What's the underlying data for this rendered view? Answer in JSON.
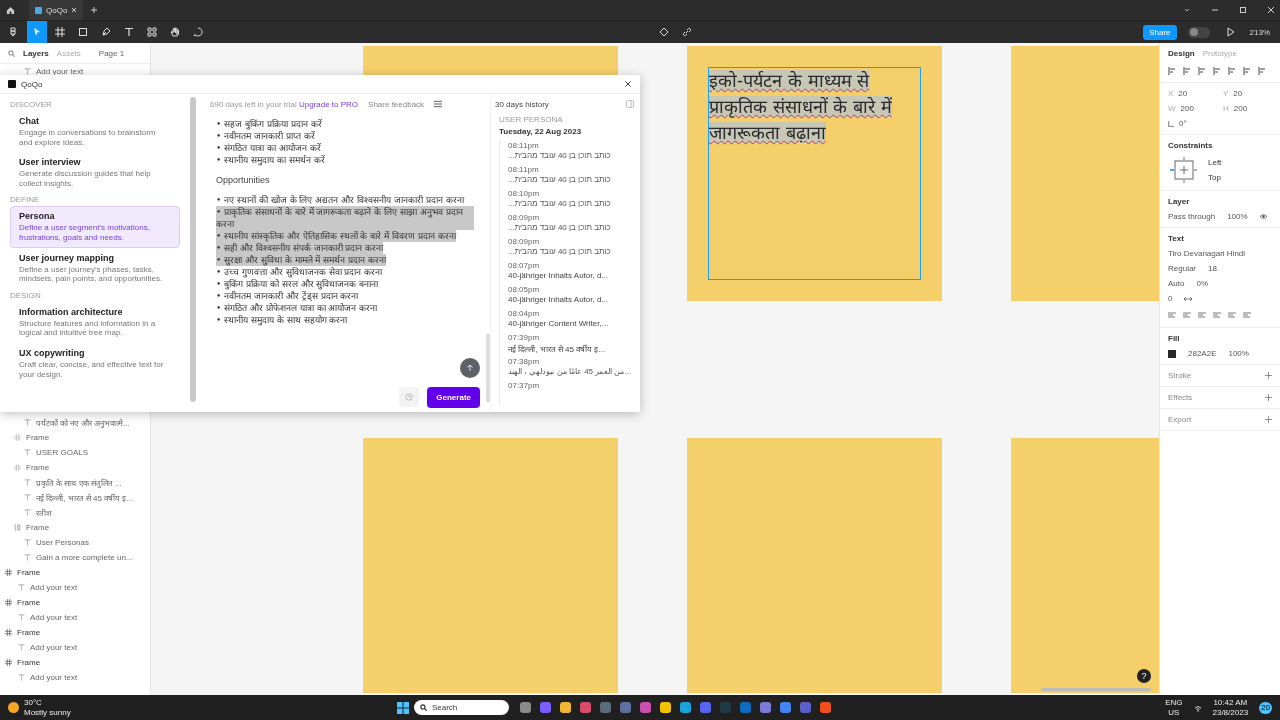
{
  "title_bar": {
    "tab": "QoQo"
  },
  "toolbar": {
    "tools": [
      {
        "kind": "menu",
        "selected": false
      },
      {
        "kind": "move",
        "selected": true
      },
      {
        "kind": "frame",
        "selected": false
      },
      {
        "kind": "shape",
        "selected": false
      },
      {
        "kind": "pen",
        "selected": false
      },
      {
        "kind": "text",
        "selected": false
      },
      {
        "kind": "resources",
        "selected": false
      },
      {
        "kind": "hand",
        "selected": false
      },
      {
        "kind": "comment",
        "selected": false
      }
    ],
    "share": "Share",
    "dev_mode": false,
    "zoom": "213%"
  },
  "layers_panel": {
    "tabs": [
      {
        "label": "Layers",
        "selected": true
      },
      {
        "label": "Assets",
        "selected": false
      }
    ],
    "page": "Page 1",
    "hidden_frame_tail": [
      {
        "kind": "text",
        "label": "Add your text"
      },
      {
        "kind": "text",
        "label": "पर्यटकों को नए और अनुभवात्मे..."
      }
    ],
    "nested_frames": [
      {
        "kind": "frame",
        "label": "Frame",
        "children": [
          {
            "kind": "text",
            "label": "USER GOALS"
          }
        ]
      },
      {
        "kind": "frame",
        "label": "Frame",
        "children": [
          {
            "kind": "text",
            "label": "प्रकृति के साथ एक संतुलित ..."
          },
          {
            "kind": "text",
            "label": "नई दिल्ली, भारत से 45 वर्षीय इ..."
          },
          {
            "kind": "text",
            "label": "रतीश"
          }
        ]
      },
      {
        "kind": "autolayout",
        "label": "Frame",
        "children": [
          {
            "kind": "text",
            "label": "User Personas"
          },
          {
            "kind": "text",
            "label": "Gain a more complete un..."
          }
        ]
      }
    ],
    "top_frames": [
      {
        "kind": "frame",
        "label": "Frame",
        "children": [
          {
            "kind": "text",
            "label": "Add your text"
          }
        ]
      },
      {
        "kind": "frame",
        "label": "Frame",
        "children": [
          {
            "kind": "text",
            "label": "Add your text"
          }
        ]
      },
      {
        "kind": "frame",
        "label": "Frame",
        "children": [
          {
            "kind": "text",
            "label": "Add your text"
          }
        ]
      },
      {
        "kind": "frame",
        "label": "Frame",
        "children": [
          {
            "kind": "text",
            "label": "Add your text"
          }
        ]
      }
    ]
  },
  "canvas": {
    "frames": [
      {
        "kind": "empty"
      },
      {
        "kind": "text",
        "text": "इको-पर्यटन के माध्यम से प्राकृतिक संसाधनों के बारे में जागरूकता बढ़ाना",
        "selected": true
      },
      {
        "kind": "empty"
      },
      {
        "kind": "empty"
      },
      {
        "kind": "empty"
      },
      {
        "kind": "empty"
      }
    ],
    "help": "?"
  },
  "plugin": {
    "name": "QoQo",
    "sidebar": [
      {
        "section": "DISCOVER",
        "cards": [
          {
            "title": "Chat",
            "description": "Engage in conversations to brainstorm and explore ideas.",
            "selected": false
          },
          {
            "title": "User interview",
            "description": "Generate discussion guides that help collect insights.",
            "selected": false
          }
        ]
      },
      {
        "section": "DEFINE",
        "cards": [
          {
            "title": "Persona",
            "description": "Define a user segment's motivations, frustrations, goals and needs.",
            "selected": true
          },
          {
            "title": "User journey mapping",
            "description": "Define a user journey's phases, tasks, mindsets, pain points, and opportunities.",
            "selected": false
          }
        ]
      },
      {
        "section": "DESIGN",
        "cards": [
          {
            "title": "Information architecture",
            "description": "Structure features and information in a logical and intuitive tree map.",
            "selected": false
          },
          {
            "title": "UX copywriting",
            "description": "Craft clear, concise, and effective text for your design.",
            "selected": false
          }
        ]
      }
    ],
    "trial": "690 days left in your trial",
    "upgrade": "Upgrade to PRO",
    "feedback": "Share feedback",
    "list_1": [
      "• सहज बुकिंग प्रक्रिया प्रदान करें",
      "• नवीनतम जानकारी प्राप्त करें",
      "• संगठित यात्रा का आयोजन करें",
      "• स्थानीय समुदाय का समर्थन करें"
    ],
    "heading": "Opportunities",
    "list_2": [
      {
        "text": "• नए स्थानों की खोज के लिए अद्यतन और विश्वसनीय जानकारी प्रदान करना",
        "highlighted": false
      },
      {
        "text": "• प्राकृतिक संसाधनों के बारे में जागरूकता बढ़ाने के लिए साझा अनुभव प्रदान करना",
        "highlighted": true
      },
      {
        "text": "• स्थानीय सांस्कृतिक और ऐतिहासिक स्थलों के बारे में विवरण प्रदान करना",
        "highlighted": true
      },
      {
        "text": "• सही और विश्वसनीय संपर्क जानकारी प्रदान करना",
        "highlighted": true
      },
      {
        "text": "• सुरक्षा और सुविधा के मामले में समर्थन प्रदान करना",
        "highlighted": true
      },
      {
        "text": "• उच्च गुणवत्ता और सुविधाजनक सेवा प्रदान करना",
        "highlighted": false
      },
      {
        "text": "• बुकिंग प्रक्रिया को सरल और सुविधाजनक बनाना",
        "highlighted": false
      },
      {
        "text": "• नवीनतम जानकारी और ट्रेंड्स प्रदान करना",
        "highlighted": false
      },
      {
        "text": "• संगठित और प्रोफेशनल यात्रा का आयोजन करना",
        "highlighted": false
      },
      {
        "text": "• स्थानीय समुदाय के साथ सहयोग करना",
        "highlighted": false
      }
    ],
    "generate": "Generate",
    "history": {
      "title": "30 days history",
      "category": "USER PERSONA",
      "date": "Tuesday, 22 Aug 2023",
      "entries": [
        {
          "time": "08:11pm",
          "text": "כותב תוכן בן 40 עובד מהבית...",
          "rtl": true
        },
        {
          "time": "08:11pm",
          "text": "כותב תוכן בן 40 עובד מהבית...",
          "rtl": true
        },
        {
          "time": "08:10pm",
          "text": "כותב תוכן בן 40 עובד מהבית...",
          "rtl": true
        },
        {
          "time": "08:09pm",
          "text": "כותב תוכן בן 40 עובד מהבית...",
          "rtl": true
        },
        {
          "time": "08:09pm",
          "text": "כותב תוכן בן 40 עובד מהבית...",
          "rtl": true
        },
        {
          "time": "08:07pm",
          "text": "40-jähriger Inhalts Autor, d...",
          "rtl": false
        },
        {
          "time": "08:05pm",
          "text": "40-jähriger Inhalts Autor, d...",
          "rtl": false
        },
        {
          "time": "08:04pm",
          "text": "40-jähriger Content Writer,...",
          "rtl": false
        },
        {
          "time": "07:39pm",
          "text": "नई दिल्ली, भारत से 45 वर्षीय इ...",
          "rtl": false
        },
        {
          "time": "07:38pm",
          "text": "...من العمر 45 عامًا من نيودلهي ، الهند",
          "rtl": true
        },
        {
          "time": "07:37pm"
        }
      ]
    }
  },
  "design_panel": {
    "tabs": [
      {
        "label": "Design",
        "selected": true
      },
      {
        "label": "Prototype",
        "selected": false
      }
    ],
    "position": [
      {
        "label": "X",
        "value": "20"
      },
      {
        "label": "Y",
        "value": "20"
      },
      {
        "label": "W",
        "value": "200"
      },
      {
        "label": "H",
        "value": "200"
      }
    ],
    "rotation": "0°",
    "constraints_title": "Constraints",
    "horizontal": "Left",
    "vertical": "Top",
    "layer_title": "Layer",
    "blend": "Pass through",
    "opacity": "100%",
    "text_title": "Text",
    "font": "Tiro Devanagari Hindi",
    "weight": "Regular",
    "size": "18",
    "line_height": "Auto",
    "letter_spacing": "0%",
    "paragraph_spacing": "0",
    "fill_title": "Fill",
    "fill_hex": "282A2E",
    "fill_opacity": "100%",
    "empty_sections": [
      "Stroke",
      "Effects",
      "Export"
    ]
  },
  "taskbar": {
    "temperature": "30°C",
    "weather": "Mostly sunny",
    "search": "Search",
    "apps": [
      {
        "color": "#8a8a8a"
      },
      {
        "color": "#7a5cff"
      },
      {
        "color": "#f2b632"
      },
      {
        "color": "#d94c6b"
      },
      {
        "color": "#5b6b7a"
      },
      {
        "color": "#5f6f9f"
      },
      {
        "color": "#c94fb0"
      },
      {
        "color": "#f2c200"
      },
      {
        "color": "#1aa3d9"
      },
      {
        "color": "#5865f2"
      },
      {
        "color": "#1e3a46"
      },
      {
        "color": "#0f6cbd"
      },
      {
        "color": "#7a7ad8"
      },
      {
        "color": "#4285f4"
      },
      {
        "color": "#5b5fc7"
      },
      {
        "color": "#f24e1e"
      }
    ],
    "language": "ENG",
    "region": "US",
    "time": "10:42 AM",
    "date": "23/8/2023",
    "notifications": "20"
  }
}
